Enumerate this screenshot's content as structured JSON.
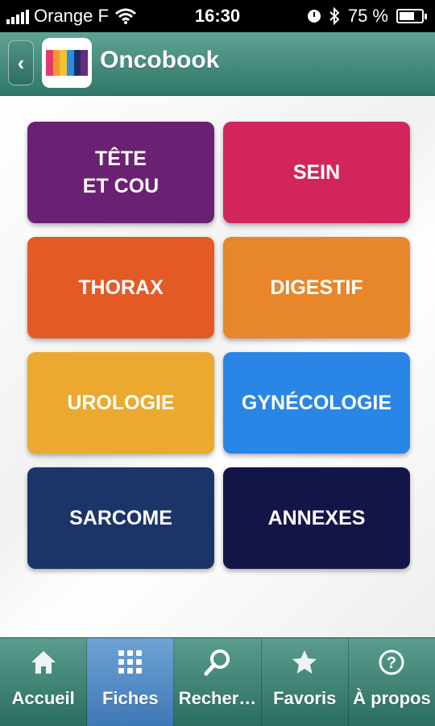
{
  "status_bar": {
    "carrier": "Orange F",
    "time": "16:30",
    "battery": "75 %"
  },
  "nav": {
    "title": "Oncobook",
    "back_icon": "chevron-left-icon",
    "logo_colors": [
      "#e23b6b",
      "#f39a2d",
      "#f1c232",
      "#2d8be0",
      "#1a2e6b",
      "#6b2a7a"
    ]
  },
  "tiles": [
    {
      "label": "TÊTE\nET COU",
      "color": "#6b2173"
    },
    {
      "label": "SEIN",
      "color": "#d2265a"
    },
    {
      "label": "THORAX",
      "color": "#e35a25"
    },
    {
      "label": "DIGESTIF",
      "color": "#e8862c"
    },
    {
      "label": "UROLOGIE",
      "color": "#eba930"
    },
    {
      "label": "GYNÉCOLOGIE",
      "color": "#2a86e6"
    },
    {
      "label": "SARCOME",
      "color": "#1b3569"
    },
    {
      "label": "ANNEXES",
      "color": "#131447"
    }
  ],
  "tabs": [
    {
      "label": "Accueil",
      "icon": "home-icon",
      "active": false
    },
    {
      "label": "Fiches",
      "icon": "grid-icon",
      "active": true
    },
    {
      "label": "Recher…",
      "icon": "search-icon",
      "active": false
    },
    {
      "label": "Favoris",
      "icon": "star-icon",
      "active": false
    },
    {
      "label": "À propos",
      "icon": "help-icon",
      "active": false
    }
  ]
}
